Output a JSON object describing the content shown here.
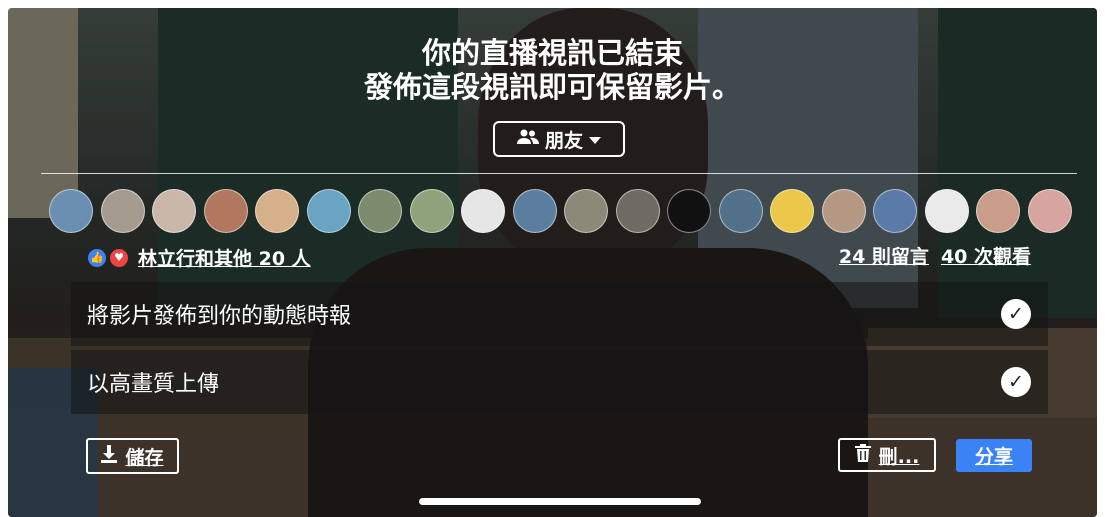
{
  "header": {
    "line1": "你的直播視訊已結束",
    "line2": "發佈這段視訊即可保留影片。"
  },
  "audience": {
    "icon": "friends-icon",
    "label": "朋友",
    "chevron": "chevron-down-icon"
  },
  "viewers": {
    "avatar_colors": [
      "#6b8fb0",
      "#a59c8f",
      "#c9b7a9",
      "#b1785f",
      "#d6b08b",
      "#6aa4c3",
      "#7d8a6c",
      "#8fa27b",
      "#e6e6e6",
      "#5b7e9e",
      "#8b8a78",
      "#6f6a62",
      "#111111",
      "#51708a",
      "#e9c84a",
      "#b59883",
      "#5a7aa8",
      "#eaeaea",
      "#c99d8a",
      "#d7a5a0"
    ],
    "reactions": [
      "like-icon",
      "love-icon"
    ],
    "names": "林立行和其他 20 人",
    "comments": "24 則留言",
    "views": "40 次觀看"
  },
  "options": [
    {
      "label": "將影片發佈到你的動態時報",
      "checked": true
    },
    {
      "label": "以高畫質上傳",
      "checked": true
    }
  ],
  "buttons": {
    "save": "儲存",
    "delete": "刪...",
    "share": "分享"
  },
  "colors": {
    "share_bg": "#3b82f6",
    "like": "#3b82f6",
    "love": "#ef4444"
  }
}
